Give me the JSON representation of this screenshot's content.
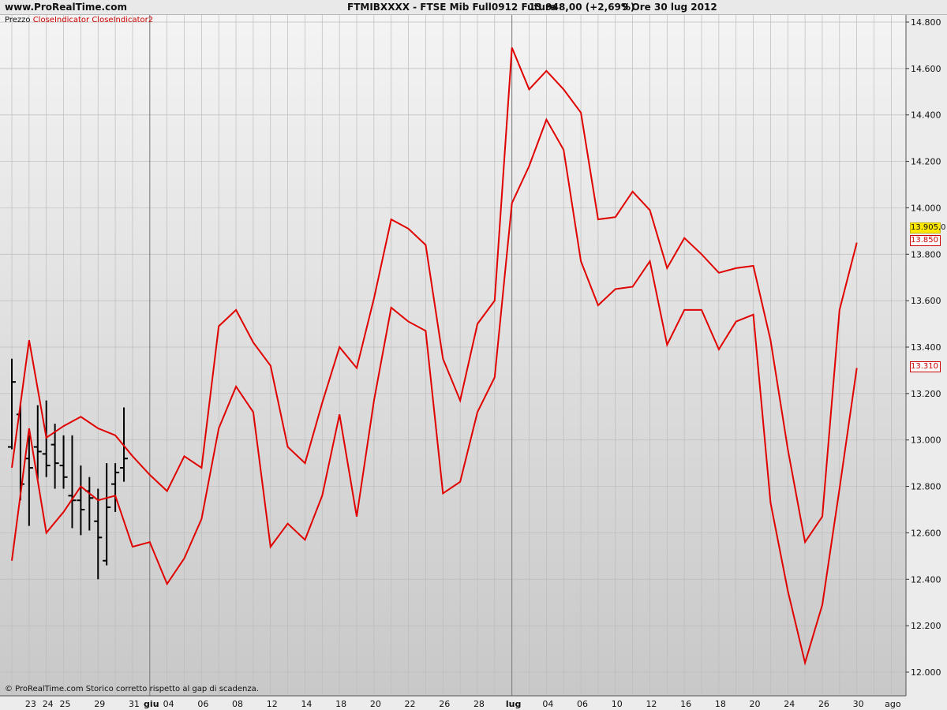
{
  "header": {
    "brand": "www.ProRealTime.com",
    "instrument": "FTMIBXXXX - FTSE Mib Full0912 Future",
    "price": "13.948,00 (+2,69%)",
    "period": "9 Ore  30 lug 2012"
  },
  "legend": {
    "price_label": "Prezzo",
    "indicator_1": "CloseIndicator",
    "indicator_2": "CloseIndicator2"
  },
  "footer": {
    "copyright": "© ProRealTime.com  Storico corretto rispetto al gap di scadenza."
  },
  "tags": {
    "last": "13.905,0",
    "upper": "13.850",
    "lower": "13.310"
  },
  "colors": {
    "bars": "#000000",
    "indicators": "#e00000",
    "last_tag": "#ffe800",
    "background_top": "#f4f4f4",
    "background_bottom": "#c8c8c8"
  },
  "chart_data": {
    "type": "ohlc",
    "ylim": [
      11900,
      14850
    ],
    "y_ticks": [
      12000,
      12200,
      12400,
      12600,
      12800,
      13000,
      13200,
      13400,
      13600,
      13800,
      14000,
      14200,
      14400,
      14600,
      14800
    ],
    "y_tick_labels": [
      "12.000",
      "12.200",
      "12.400",
      "12.600",
      "12.800",
      "13.000",
      "13.200",
      "13.400",
      "13.600",
      "13.800",
      "14.000",
      "14.200",
      "14.400",
      "14.600",
      "14.800"
    ],
    "x_labels": [
      {
        "label": "23",
        "index": 1
      },
      {
        "label": "24",
        "index": 2
      },
      {
        "label": "25",
        "index": 3
      },
      {
        "label": "29",
        "index": 5
      },
      {
        "label": "31",
        "index": 7
      },
      {
        "label": "giu",
        "index": 8,
        "bold": true
      },
      {
        "label": "04",
        "index": 9
      },
      {
        "label": "06",
        "index": 11
      },
      {
        "label": "08",
        "index": 13
      },
      {
        "label": "12",
        "index": 15
      },
      {
        "label": "14",
        "index": 17
      },
      {
        "label": "18",
        "index": 19
      },
      {
        "label": "20",
        "index": 21
      },
      {
        "label": "22",
        "index": 23
      },
      {
        "label": "26",
        "index": 25
      },
      {
        "label": "28",
        "index": 27
      },
      {
        "label": "lug",
        "index": 29,
        "bold": true
      },
      {
        "label": "04",
        "index": 31
      },
      {
        "label": "06",
        "index": 33
      },
      {
        "label": "10",
        "index": 35
      },
      {
        "label": "12",
        "index": 37
      },
      {
        "label": "16",
        "index": 39
      },
      {
        "label": "18",
        "index": 41
      },
      {
        "label": "20",
        "index": 43
      },
      {
        "label": "24",
        "index": 45
      },
      {
        "label": "26",
        "index": 47
      },
      {
        "label": "30",
        "index": 49
      },
      {
        "label": "ago",
        "index": 51
      }
    ],
    "month_separators": [
      8,
      29
    ],
    "bars": [
      {
        "i": 0,
        "o": 12970,
        "h": 13350,
        "l": 12960,
        "c": 13250
      },
      {
        "i": 0.5,
        "o": 13110,
        "h": 13160,
        "l": 12740,
        "c": 12810
      },
      {
        "i": 1,
        "o": 12920,
        "h": 13020,
        "l": 12630,
        "c": 12880
      },
      {
        "i": 1.5,
        "o": 12970,
        "h": 13150,
        "l": 12830,
        "c": 12950
      },
      {
        "i": 2,
        "o": 12940,
        "h": 13170,
        "l": 12840,
        "c": 12890
      },
      {
        "i": 2.5,
        "o": 12980,
        "h": 13070,
        "l": 12790,
        "c": 12900
      },
      {
        "i": 3,
        "o": 12890,
        "h": 13020,
        "l": 12790,
        "c": 12840
      },
      {
        "i": 3.5,
        "o": 12760,
        "h": 13020,
        "l": 12620,
        "c": 12740
      },
      {
        "i": 4,
        "o": 12740,
        "h": 12890,
        "l": 12590,
        "c": 12700
      },
      {
        "i": 4.5,
        "o": 12780,
        "h": 12840,
        "l": 12610,
        "c": 12750
      },
      {
        "i": 5,
        "o": 12650,
        "h": 12790,
        "l": 12400,
        "c": 12580
      },
      {
        "i": 5.5,
        "o": 12480,
        "h": 12900,
        "l": 12460,
        "c": 12710
      },
      {
        "i": 6,
        "o": 12810,
        "h": 12900,
        "l": 12690,
        "c": 12860
      },
      {
        "i": 6.5,
        "o": 12880,
        "h": 13140,
        "l": 12820,
        "c": 12920
      }
    ],
    "series": [
      {
        "name": "CloseIndicator",
        "color": "#e00000",
        "x": [
          0,
          1,
          2,
          3,
          4,
          5,
          6,
          7,
          8,
          9,
          10,
          11,
          12,
          13,
          14,
          15,
          16,
          17,
          18,
          19,
          20,
          21,
          22,
          23,
          24,
          25,
          26,
          27,
          28,
          29,
          30,
          31,
          32,
          33,
          34,
          35,
          36,
          37,
          38,
          39,
          40,
          41,
          42,
          43,
          44,
          45,
          46,
          47,
          48,
          49
        ],
        "values": [
          12880,
          13430,
          13010,
          13060,
          13100,
          13050,
          13020,
          12930,
          12850,
          12780,
          12930,
          12880,
          13490,
          13560,
          13420,
          13320,
          12970,
          12900,
          13160,
          13400,
          13310,
          13610,
          13950,
          13910,
          13840,
          13350,
          13170,
          13500,
          13600,
          14690,
          14510,
          14590,
          14510,
          14410,
          13950,
          13960,
          14070,
          13990,
          13740,
          13870,
          13800,
          13720,
          13740,
          13750,
          13430,
          12960,
          12560,
          12670,
          13560,
          13850
        ]
      },
      {
        "name": "CloseIndicator2",
        "color": "#e00000",
        "x": [
          0,
          1,
          2,
          3,
          4,
          5,
          6,
          7,
          8,
          9,
          10,
          11,
          12,
          13,
          14,
          15,
          16,
          17,
          18,
          19,
          20,
          21,
          22,
          23,
          24,
          25,
          26,
          27,
          28,
          29,
          30,
          31,
          32,
          33,
          34,
          35,
          36,
          37,
          38,
          39,
          40,
          41,
          42,
          43,
          44,
          45,
          46,
          47,
          48,
          49
        ],
        "values": [
          12480,
          13050,
          12600,
          12690,
          12800,
          12740,
          12760,
          12540,
          12560,
          12380,
          12490,
          12660,
          13050,
          13230,
          13120,
          12540,
          12640,
          12570,
          12760,
          13110,
          12670,
          13170,
          13570,
          13510,
          13470,
          12770,
          12820,
          13120,
          13270,
          14020,
          14180,
          14380,
          14250,
          13770,
          13580,
          13650,
          13660,
          13770,
          13410,
          13560,
          13560,
          13390,
          13510,
          13540,
          12730,
          12350,
          12040,
          12290,
          12790,
          13310
        ]
      }
    ]
  }
}
